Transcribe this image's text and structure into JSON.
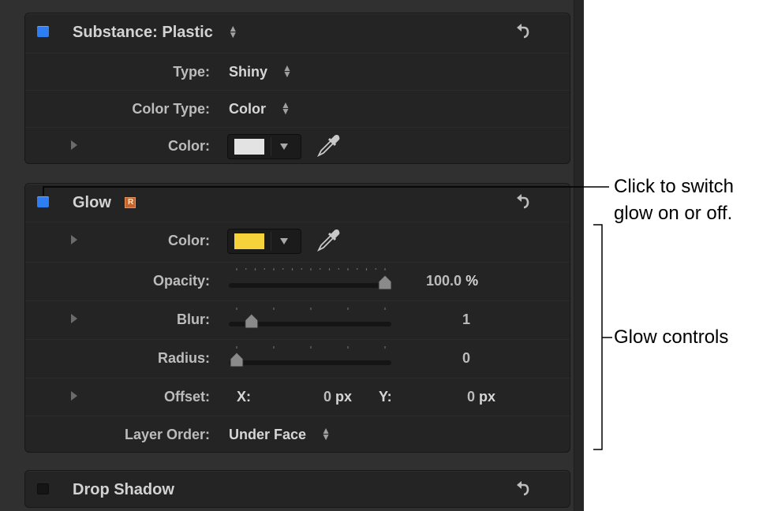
{
  "substance": {
    "title_prefix": "Substance: ",
    "title_value": "Plastic",
    "enabled": true,
    "rows": {
      "type": {
        "label": "Type:",
        "value": "Shiny"
      },
      "color_type": {
        "label": "Color Type:",
        "value": "Color"
      },
      "color": {
        "label": "Color:",
        "swatch": "#e3e3e3"
      }
    }
  },
  "glow": {
    "title": "Glow",
    "badge": "R",
    "enabled": true,
    "rows": {
      "color": {
        "label": "Color:",
        "swatch": "#f6d33a"
      },
      "opacity": {
        "label": "Opacity:",
        "value": "100.0",
        "unit": "%",
        "level": 1.0
      },
      "blur": {
        "label": "Blur:",
        "value": "1",
        "level": 0.1
      },
      "radius": {
        "label": "Radius:",
        "value": "0",
        "level": 0.0
      },
      "offset": {
        "label": "Offset:",
        "x_label": "X:",
        "x_value": "0",
        "y_label": "Y:",
        "y_value": "0",
        "unit": "px"
      },
      "layer_order": {
        "label": "Layer Order:",
        "value": "Under Face"
      }
    }
  },
  "drop_shadow": {
    "title": "Drop Shadow",
    "enabled": false
  },
  "callouts": {
    "switch_line1": "Click to switch",
    "switch_line2": "glow on or off.",
    "controls": "Glow controls"
  },
  "colors": {
    "panel": "#303030",
    "section": "#242424",
    "toggle_on": "#2d7df3",
    "badge": "#c8642a"
  },
  "icons": [
    "updown-arrows-icon",
    "reset-arrow-icon",
    "disclosure-triangle-icon",
    "eyedropper-icon",
    "dropdown-arrow-icon",
    "rig-badge-icon"
  ]
}
